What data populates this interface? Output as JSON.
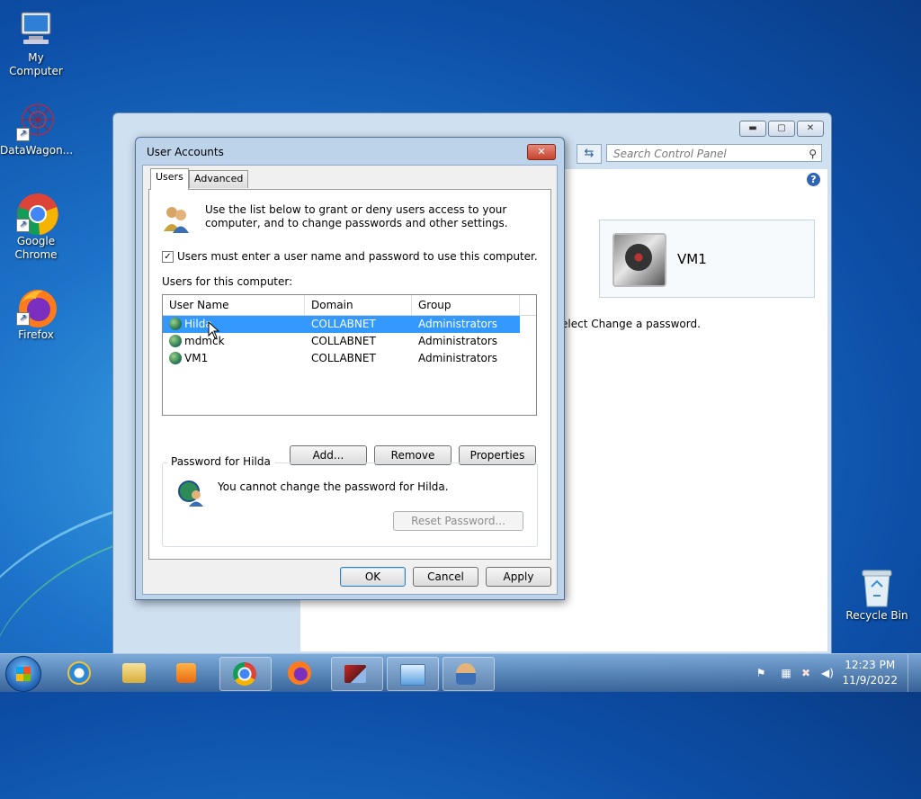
{
  "desktop": {
    "icons": [
      {
        "label": "My Computer"
      },
      {
        "label": "DataWagon..."
      },
      {
        "label": "Google Chrome"
      },
      {
        "label": "Firefox"
      },
      {
        "label": "Recycle Bin"
      }
    ]
  },
  "control_panel": {
    "search_placeholder": "Search Control Panel",
    "user_card_name": "VM1",
    "body_text": "elect Change a password."
  },
  "dialog": {
    "title": "User Accounts",
    "tabs": [
      {
        "label": "Users"
      },
      {
        "label": "Advanced"
      }
    ],
    "intro": "Use the list below to grant or deny users access to your computer, and to change passwords and other settings.",
    "checkbox_label": "Users must enter a user name and password to use this computer.",
    "checkbox_checked": true,
    "users_label": "Users for this computer:",
    "columns": [
      "User Name",
      "Domain",
      "Group"
    ],
    "users": [
      {
        "name": "Hilda",
        "domain": "COLLABNET",
        "group": "Administrators",
        "selected": true
      },
      {
        "name": "mdmck",
        "domain": "COLLABNET",
        "group": "Administrators",
        "selected": false
      },
      {
        "name": "VM1",
        "domain": "COLLABNET",
        "group": "Administrators",
        "selected": false
      }
    ],
    "buttons": {
      "add": "Add...",
      "remove": "Remove",
      "properties": "Properties"
    },
    "password_group_title": "Password for Hilda",
    "password_text": "You cannot change the password for Hilda.",
    "reset_password": "Reset Password...",
    "footer": {
      "ok": "OK",
      "cancel": "Cancel",
      "apply": "Apply"
    }
  },
  "taskbar": {
    "time": "12:23 PM",
    "date": "11/9/2022",
    "items": [
      "internet-explorer",
      "file-explorer",
      "media-player",
      "chrome",
      "firefox",
      "remote-desktop",
      "control-panel",
      "user-accounts"
    ]
  }
}
